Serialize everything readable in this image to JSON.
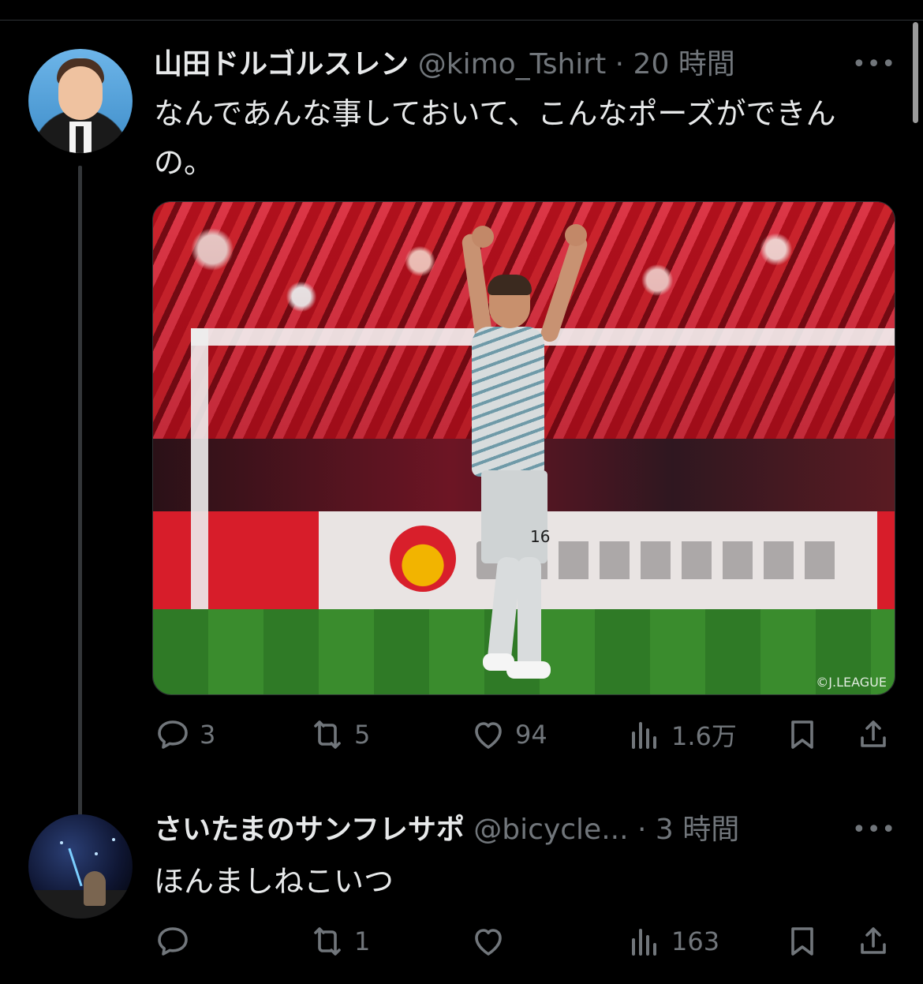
{
  "tweets": [
    {
      "display_name": "山田ドルゴルスレン",
      "handle": "@kimo_Tshirt",
      "time": "· 20 時間",
      "text": "なんであんな事しておいて、こんなポーズができんの。",
      "media": {
        "watermark": "©J.LEAGUE",
        "jersey_number": "16"
      },
      "actions": {
        "reply": "3",
        "retweet": "5",
        "like": "94",
        "views": "1.6万"
      }
    },
    {
      "display_name": "さいたまのサンフレサポ",
      "handle": "@bicycle...",
      "time": "· 3 時間",
      "text": "ほんましねこいつ",
      "actions": {
        "reply": "",
        "retweet": "1",
        "like": "",
        "views": "163"
      }
    }
  ],
  "ui": {
    "more": "•••"
  },
  "colors": {
    "background": "#000000",
    "text": "#e7e9ea",
    "muted": "#71767b",
    "divider": "#2f3336"
  },
  "icons": [
    "reply-icon",
    "retweet-icon",
    "like-icon",
    "views-icon",
    "bookmark-icon",
    "share-icon",
    "more-icon"
  ]
}
